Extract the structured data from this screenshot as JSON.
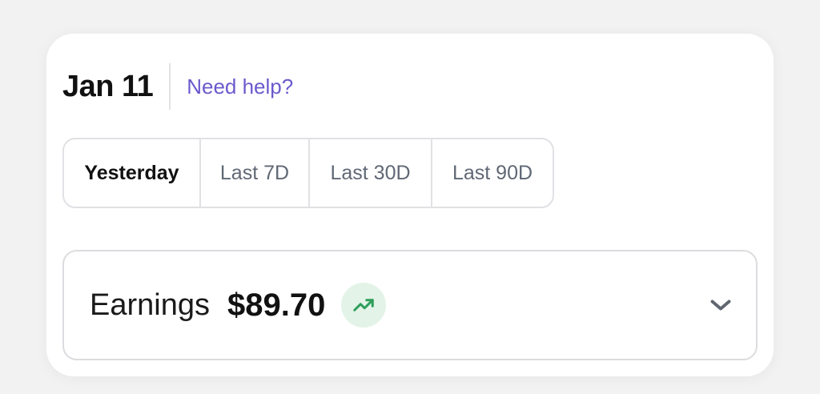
{
  "header": {
    "date": "Jan 11",
    "help_link": "Need help?"
  },
  "ranges": {
    "items": [
      "Yesterday",
      "Last 7D",
      "Last 30D",
      "Last 90D"
    ],
    "selected": "Yesterday"
  },
  "earnings": {
    "label": "Earnings",
    "value": "$89.70",
    "trend_icon": "trending-up-icon",
    "expand_icon": "chevron-down-icon"
  },
  "colors": {
    "accent": "#6a5acd",
    "trend_green": "#2e9e5b",
    "trend_bg": "#e3f3e8",
    "chevron": "#5f6670"
  }
}
